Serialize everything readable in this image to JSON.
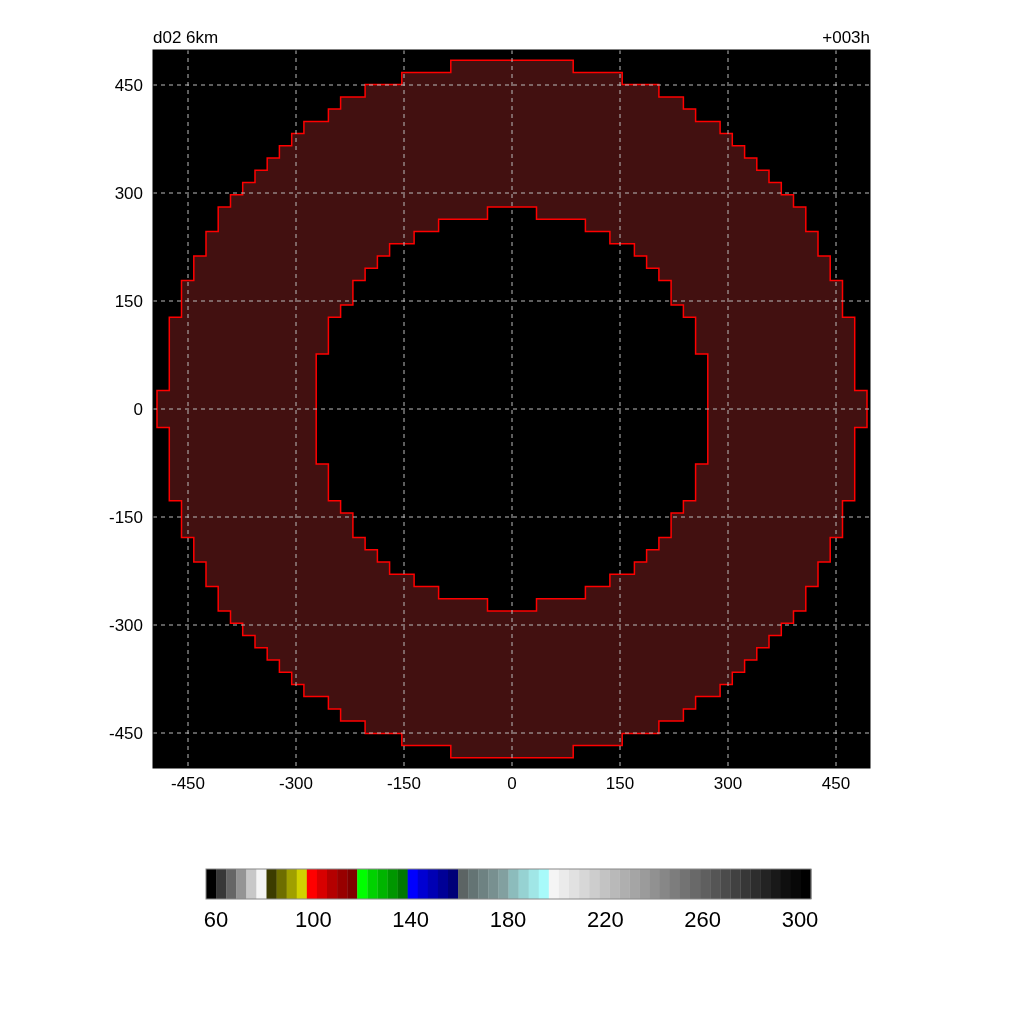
{
  "title_left": "d02 6km",
  "title_right": "+003h",
  "y_ticks": [
    "450",
    "300",
    "150",
    "0",
    "-150",
    "-300",
    "-450"
  ],
  "x_ticks": [
    "-450",
    "-300",
    "-150",
    "0",
    "150",
    "300",
    "450"
  ],
  "colorbar": {
    "segments": [
      {
        "color": "#000000"
      },
      {
        "color": "#383838"
      },
      {
        "color": "#666666"
      },
      {
        "color": "#949494"
      },
      {
        "color": "#c8c8c8"
      },
      {
        "color": "#f5f5f5"
      },
      {
        "color": "#3c3c00"
      },
      {
        "color": "#6e6e00"
      },
      {
        "color": "#a0a000"
      },
      {
        "color": "#d2d200"
      },
      {
        "color": "#ff0000"
      },
      {
        "color": "#d80000"
      },
      {
        "color": "#b40000"
      },
      {
        "color": "#980000"
      },
      {
        "color": "#800000"
      },
      {
        "color": "#00ff00"
      },
      {
        "color": "#00d200"
      },
      {
        "color": "#00b400"
      },
      {
        "color": "#009600"
      },
      {
        "color": "#007800"
      },
      {
        "color": "#0000ff"
      },
      {
        "color": "#0000d2"
      },
      {
        "color": "#0000b4"
      },
      {
        "color": "#000096"
      },
      {
        "color": "#000078"
      },
      {
        "color": "#5c6464"
      },
      {
        "color": "#647474"
      },
      {
        "color": "#6e8282"
      },
      {
        "color": "#789090"
      },
      {
        "color": "#82a0a0"
      },
      {
        "color": "#8cbcbc"
      },
      {
        "color": "#96d2d2"
      },
      {
        "color": "#a0e6e6"
      },
      {
        "color": "#a8fafa"
      },
      {
        "color": "#f5f5f5"
      },
      {
        "color": "#ebebeb"
      },
      {
        "color": "#e1e1e1"
      },
      {
        "color": "#d7d7d7"
      },
      {
        "color": "#cdcdcd"
      },
      {
        "color": "#c3c3c3"
      },
      {
        "color": "#b9b9b9"
      },
      {
        "color": "#afafaf"
      },
      {
        "color": "#a5a5a5"
      },
      {
        "color": "#9b9b9b"
      },
      {
        "color": "#919191"
      },
      {
        "color": "#878787"
      },
      {
        "color": "#7d7d7d"
      },
      {
        "color": "#737373"
      },
      {
        "color": "#696969"
      },
      {
        "color": "#5f5f5f"
      },
      {
        "color": "#555555"
      },
      {
        "color": "#4b4b4b"
      },
      {
        "color": "#414141"
      },
      {
        "color": "#373737"
      },
      {
        "color": "#2d2d2d"
      },
      {
        "color": "#232323"
      },
      {
        "color": "#191919"
      },
      {
        "color": "#0f0f0f"
      },
      {
        "color": "#080808"
      },
      {
        "color": "#000000"
      }
    ],
    "labels": [
      "60",
      "100",
      "140",
      "180",
      "220",
      "260",
      "300"
    ]
  }
}
